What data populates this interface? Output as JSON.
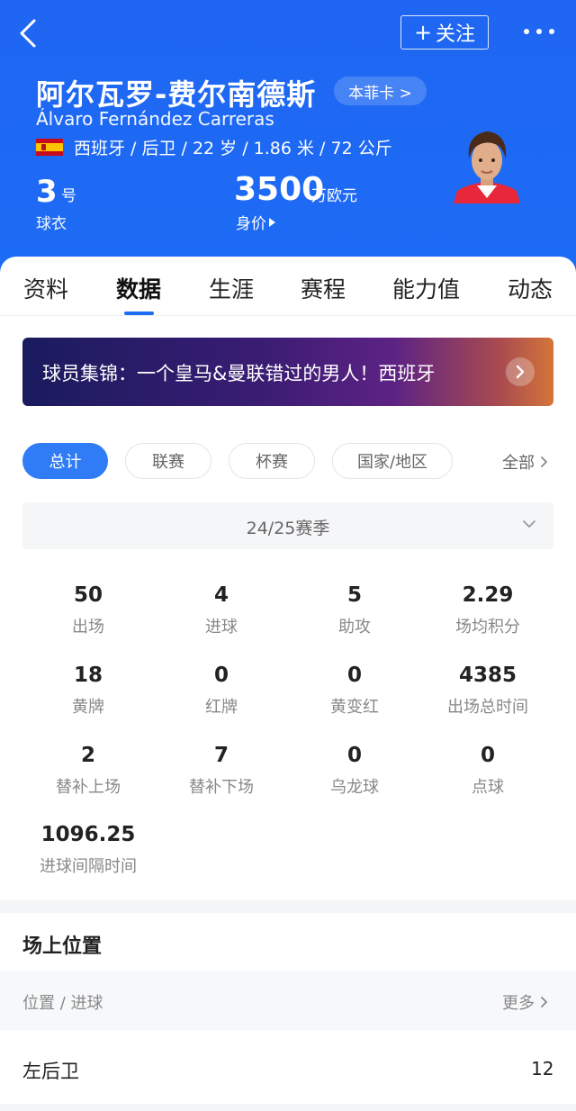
{
  "header": {
    "follow_label": "关注",
    "follow_plus": "+",
    "player_name_cn": "阿尔瓦罗-费尔南德斯",
    "player_card_label": "本菲卡 >",
    "player_name_en": "Álvaro Fernández Carreras",
    "info_line": "西班牙 / 后卫 / 22 岁 / 1.86 米 / 72 公斤",
    "jersey_number": "3",
    "jersey_unit": "号",
    "jersey_label": "球衣",
    "market_value": "3500",
    "market_value_unit": "万欧元",
    "market_value_label": "身价"
  },
  "tabs": [
    "资料",
    "数据",
    "生涯",
    "赛程",
    "能力值",
    "动态"
  ],
  "banner": {
    "text": "球员集锦：一个皇马&曼联错过的男人！西班牙"
  },
  "filters": {
    "chips": [
      "总计",
      "联赛",
      "杯赛",
      "国家/地区"
    ],
    "all_label": "全部"
  },
  "season": {
    "label": "24/25赛季"
  },
  "stats": [
    {
      "value": "50",
      "label": "出场"
    },
    {
      "value": "4",
      "label": "进球"
    },
    {
      "value": "5",
      "label": "助攻"
    },
    {
      "value": "2.29",
      "label": "场均积分"
    },
    {
      "value": "18",
      "label": "黄牌"
    },
    {
      "value": "0",
      "label": "红牌"
    },
    {
      "value": "0",
      "label": "黄变红"
    },
    {
      "value": "4385",
      "label": "出场总时间"
    },
    {
      "value": "2",
      "label": "替补上场"
    },
    {
      "value": "7",
      "label": "替补下场"
    },
    {
      "value": "0",
      "label": "乌龙球"
    },
    {
      "value": "0",
      "label": "点球"
    },
    {
      "value": "1096.25",
      "label": "进球间隔时间"
    }
  ],
  "positions": {
    "section_title": "场上位置",
    "header_left": "位置 / 进球",
    "more_label": "更多",
    "rows": [
      {
        "position": "左后卫",
        "goals": "12"
      }
    ]
  },
  "colors": {
    "header_blue": "#1d6cf5",
    "active_chip": "#2f7cf6"
  }
}
